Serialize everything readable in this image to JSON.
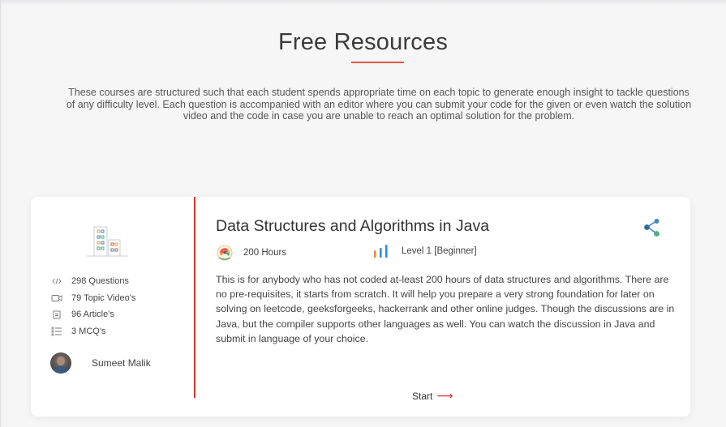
{
  "section": {
    "title": "Free Resources",
    "intro": "These courses are structured such that each student spends appropriate time on each topic to generate enough insight to tackle questions of any difficulty level. Each question is accompanied with an editor where you can submit your code for the given or even watch the solution video and the code in case you are unable to reach an optimal solution for the problem."
  },
  "course": {
    "title": "Data Structures and Algorithms in Java",
    "hours": "200 Hours",
    "level": "Level 1 [Beginner]",
    "description": "This is for anybody who has not coded at-least 200 hours of data structures and algorithms. There are no pre-requisites, it starts from scratch. It will help you prepare a very strong foundation for later on solving on leetcode, geeksforgeeks, hackerrank and other online judges. Though the discussions are in Java, but the compiler supports other languages as well. You can watch the discussion in Java and submit in language of your choice.",
    "stats": [
      {
        "icon": "code-icon",
        "label": "298 Questions"
      },
      {
        "icon": "video-icon",
        "label": "79 Topic Video's"
      },
      {
        "icon": "article-icon",
        "label": "96 Article's"
      },
      {
        "icon": "list-icon",
        "label": "3 MCQ's"
      }
    ],
    "author": "Sumeet Malik",
    "start_label": "Start",
    "start_arrow": "⟶"
  },
  "colors": {
    "accent": "#d8342c",
    "share": "#3c8ec0",
    "share_green": "#4caf7d",
    "level_orange": "#f0883a",
    "level_blue": "#2f8fd0"
  }
}
